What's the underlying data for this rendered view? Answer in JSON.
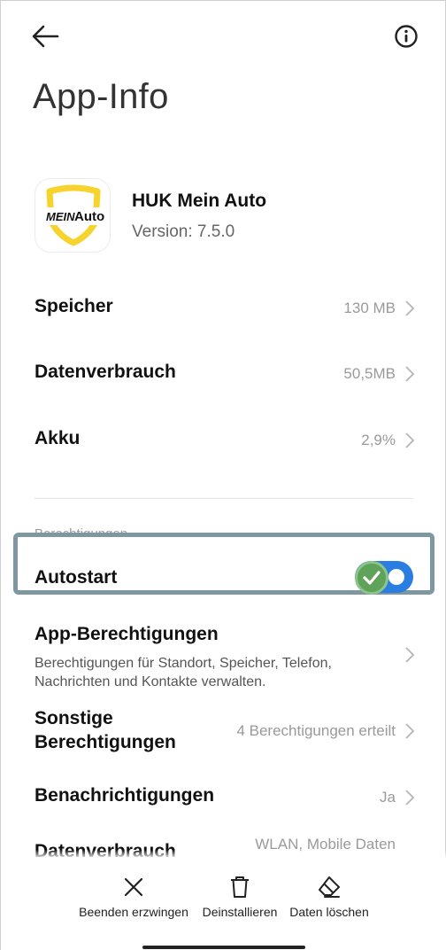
{
  "header": {
    "title": "App-Info"
  },
  "app": {
    "name": "HUK Mein Auto",
    "version": "Version: 7.5.0",
    "logo_text_left": "MEIN",
    "logo_text_right": "Auto"
  },
  "storage_rows": [
    {
      "label": "Speicher",
      "value": "130 MB"
    },
    {
      "label": "Datenverbrauch",
      "value": "50,5MB"
    },
    {
      "label": "Akku",
      "value": "2,9%"
    }
  ],
  "permissions": {
    "section_label": "Berechtigungen",
    "autostart": {
      "label": "Autostart",
      "enabled": true
    },
    "app_permissions": {
      "label": "App-Berechtigungen",
      "description": "Berechtigungen für Standort, Speicher, Telefon, Nachrichten und Kontakte verwalten."
    },
    "other_permissions": {
      "label_line1": "Sonstige",
      "label_line2": "Berechtigungen",
      "value": "4 Berechtigungen erteilt"
    },
    "notifications": {
      "label": "Benachrichtigungen",
      "value": "Ja"
    },
    "data_usage": {
      "label": "Datenverbrauch",
      "value": "WLAN, Mobile Daten"
    }
  },
  "actions": [
    {
      "label": "Beenden erzwingen",
      "icon": "close-icon"
    },
    {
      "label": "Deinstallieren",
      "icon": "trash-icon"
    },
    {
      "label": "Daten löschen",
      "icon": "eraser-icon"
    }
  ],
  "colors": {
    "accent": "#2a7de1",
    "highlight_border": "#7f97a0",
    "check_badge": "#5fa35a",
    "logo_yellow": "#f6d32d"
  }
}
